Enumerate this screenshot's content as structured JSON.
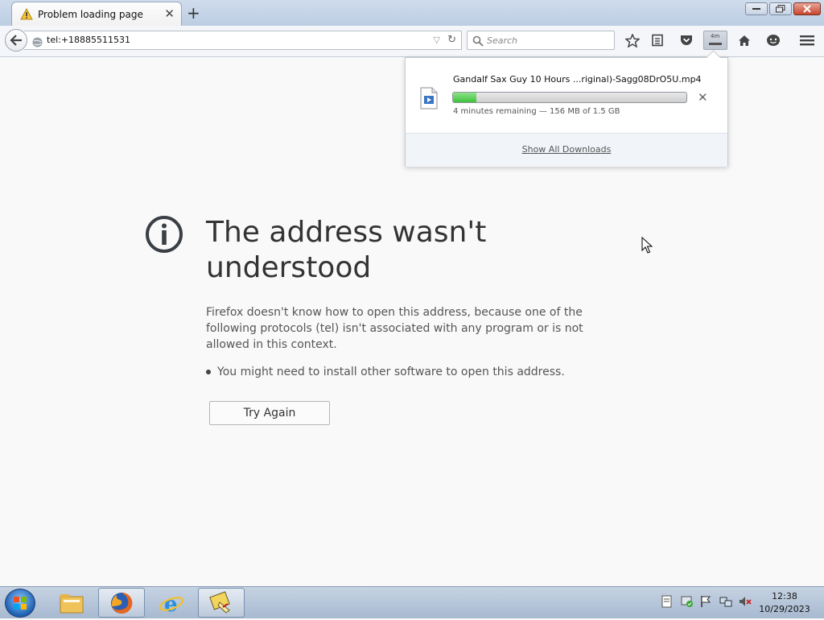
{
  "tab": {
    "title": "Problem loading page"
  },
  "navbar": {
    "url": "tel:+18885511531",
    "search_placeholder": "Search",
    "download_indicator": "4m"
  },
  "error": {
    "title": "The address wasn't understood",
    "description": "Firefox doesn't know how to open this address, because one of the following protocols (tel) isn't associated with any program or is not allowed in this context.",
    "bullet": "You might need to install other software to open this address.",
    "try_again": "Try Again"
  },
  "downloads": {
    "filename": "Gandalf Sax Guy 10 Hours ...riginal)-Sagg08DrO5U.mp4",
    "progress_percent": 10,
    "status": "4 minutes remaining — 156 MB of 1.5 GB",
    "show_all": "Show All Downloads"
  },
  "taskbar": {
    "apps": [
      "windows-explorer",
      "firefox",
      "internet-explorer",
      "paint-tool"
    ],
    "time": "12:38",
    "date": "10/29/2023"
  }
}
